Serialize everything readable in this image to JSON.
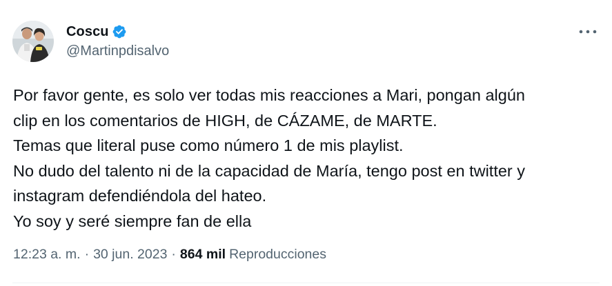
{
  "author": {
    "display_name": "Coscu",
    "handle": "@Martinpdisalvo",
    "verified": true,
    "avatar_icon": "profile-photo-icon"
  },
  "menu_icon": "more-horizontal-icon",
  "tweet": {
    "lines": [
      "Por favor gente, es solo ver todas mis reacciones a Mari, pongan algún",
      "clip en los comentarios de HIGH, de CÁZAME, de MARTE.",
      "Temas que literal puse como número 1 de mis playlist.",
      "No dudo del talento ni de la capacidad de María, tengo post en twitter y",
      "instagram defendiéndola del hateo.",
      "Yo soy y seré siempre fan de ella"
    ]
  },
  "meta": {
    "time": "12:23 a. m.",
    "separator": "·",
    "date": "30 jun. 2023",
    "views_count": "864 mil",
    "views_label": "Reproducciones"
  },
  "colors": {
    "text": "#0f1419",
    "secondary": "#536471",
    "verified_blue": "#1d9bf0",
    "divider": "#eff3f4"
  }
}
